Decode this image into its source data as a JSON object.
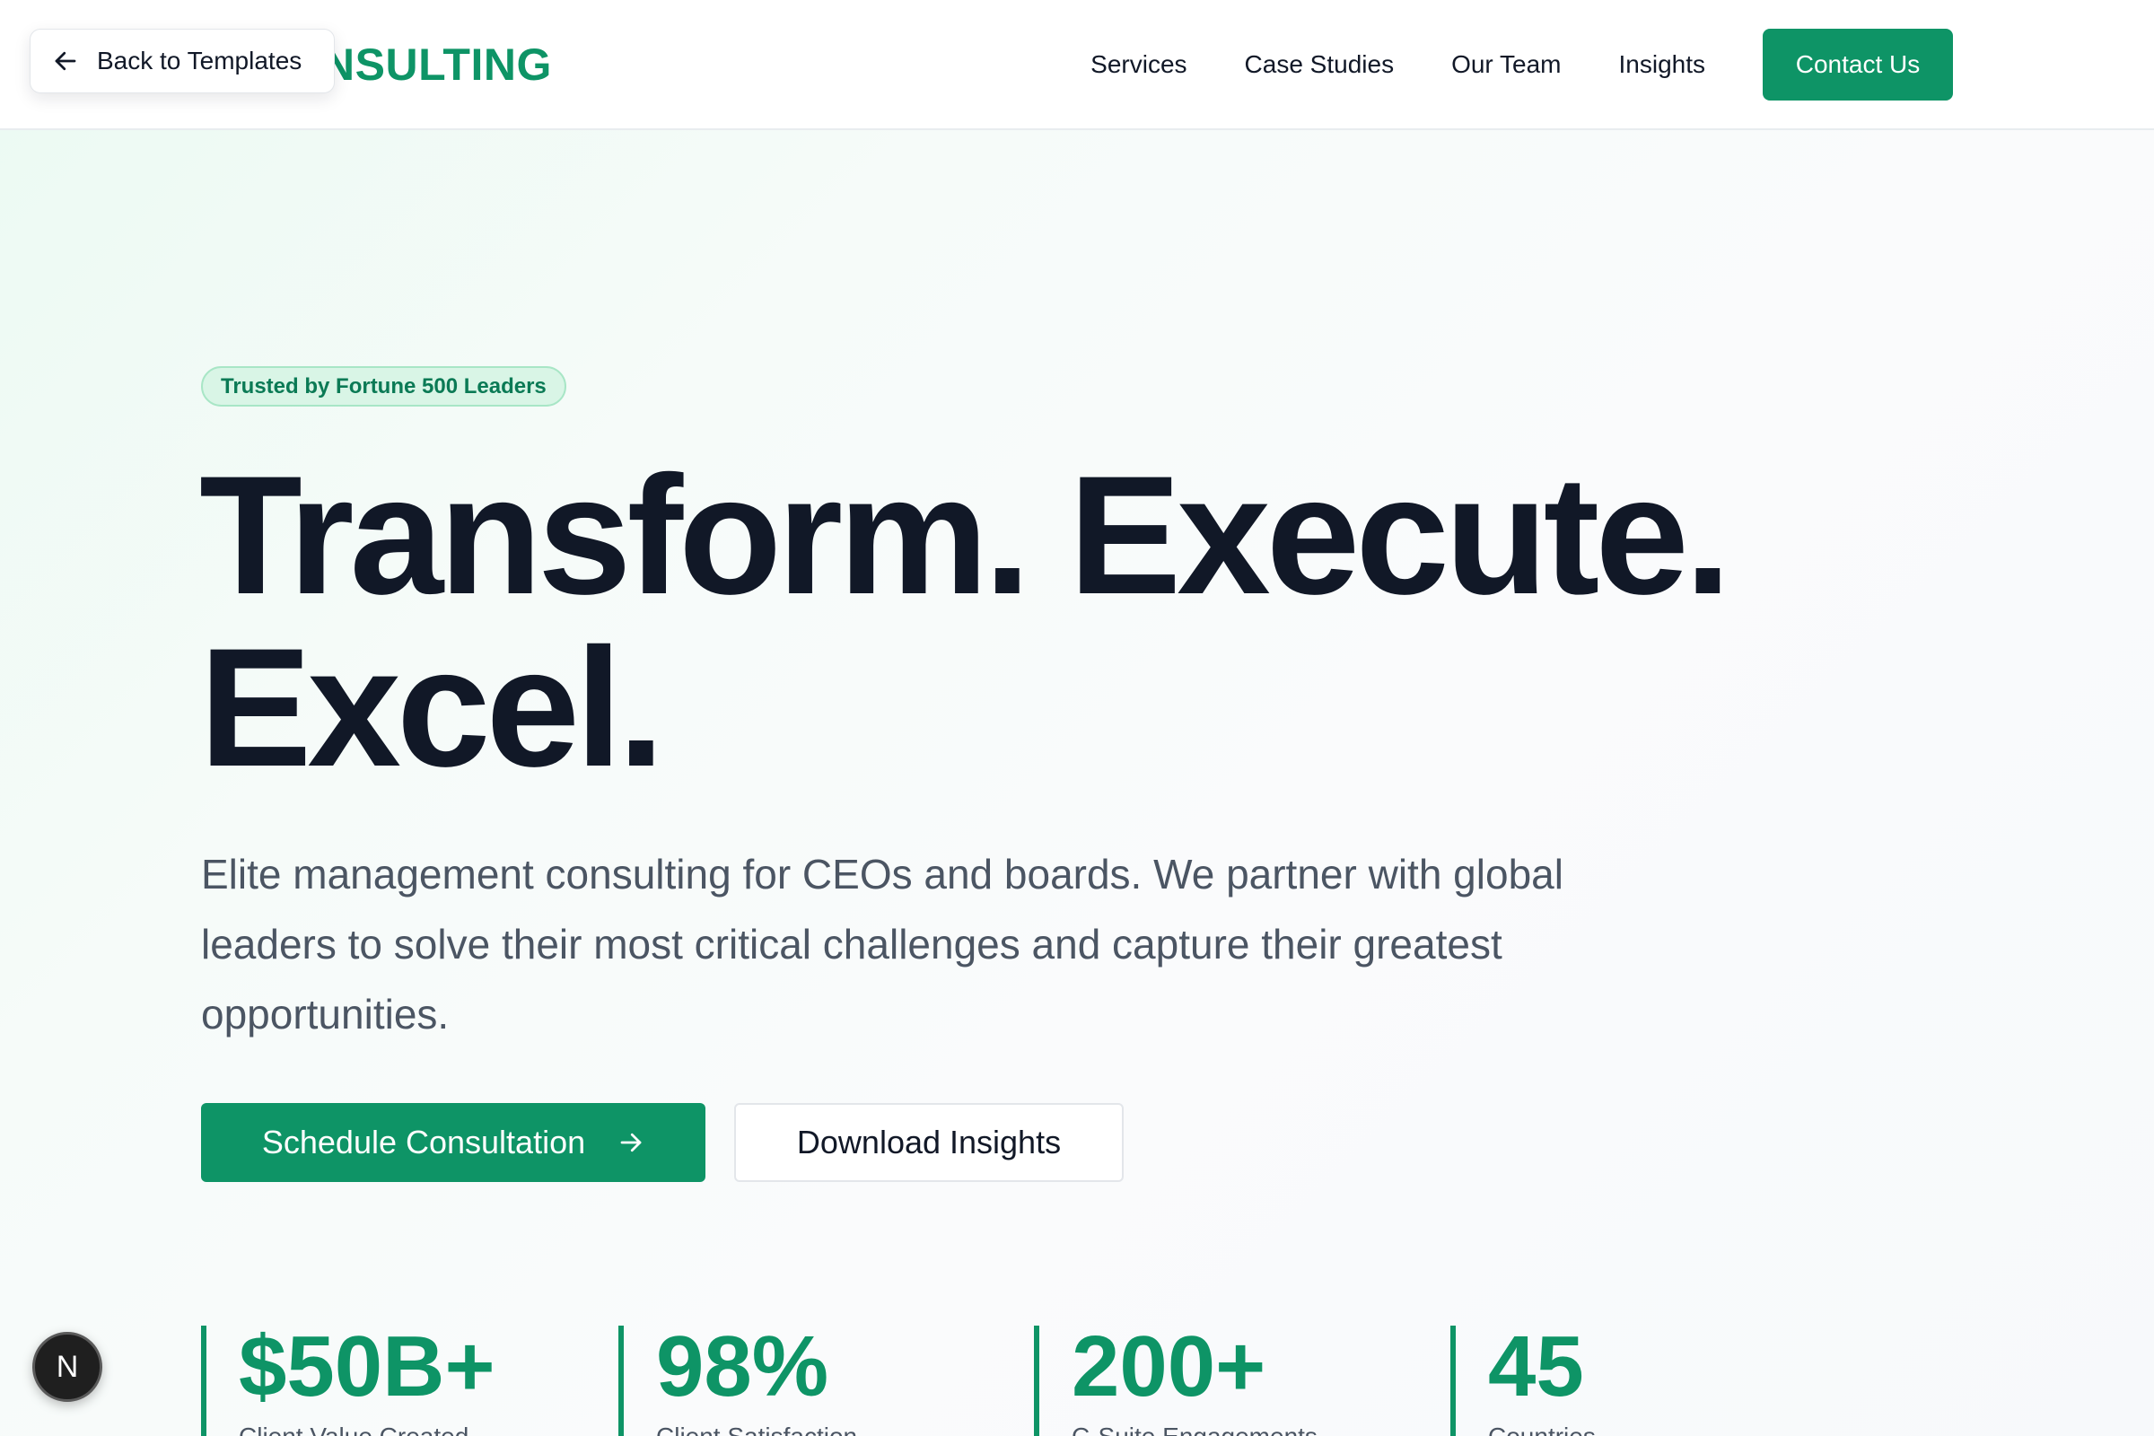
{
  "overlay": {
    "back_label": "Back to Templates",
    "dev_badge": "N"
  },
  "header": {
    "brand_name": "CONSULTING",
    "nav": [
      "Services",
      "Case Studies",
      "Our Team",
      "Insights"
    ],
    "contact_label": "Contact Us"
  },
  "hero": {
    "badge": "Trusted by Fortune 500 Leaders",
    "headline_line1": "Transform. Execute.",
    "headline_line2": "Excel.",
    "subtext": "Elite management consulting for CEOs and boards. We partner with global leaders to solve their most critical challenges and capture their greatest opportunities.",
    "primary_cta": "Schedule Consultation",
    "secondary_cta": "Download Insights"
  },
  "stats": [
    {
      "value": "$50B+",
      "label": "Client Value Created"
    },
    {
      "value": "98%",
      "label": "Client Satisfaction"
    },
    {
      "value": "200+",
      "label": "C-Suite Engagements"
    },
    {
      "value": "45",
      "label": "Countries"
    }
  ],
  "colors": {
    "accent": "#0e9466",
    "text": "#111827",
    "muted": "#4b5563"
  },
  "icons": {
    "back": "arrow-left-icon",
    "cta": "arrow-right-icon",
    "brand": "brand-logo-icon"
  }
}
